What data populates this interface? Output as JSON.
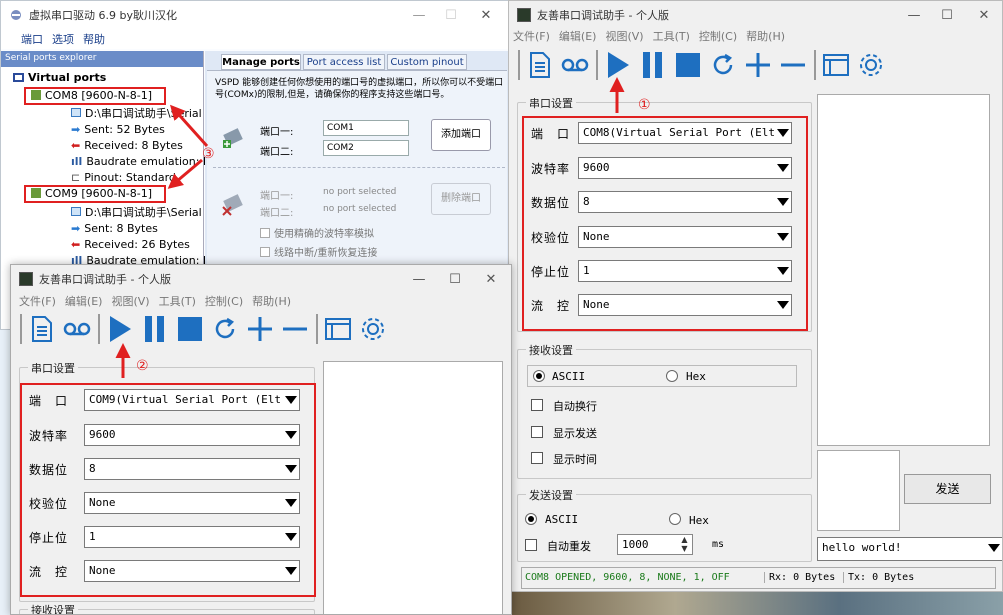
{
  "vspd": {
    "title": "虚拟串口驱动 6.9 by耿川汉化",
    "menu": [
      "端口",
      "选项",
      "帮助"
    ],
    "explorer_title": "Serial ports explorer",
    "tree": {
      "root": "Virtual ports",
      "com8": "COM8 [9600-N-8-1]",
      "com8_items": [
        "D:\\串口调试助手\\Serial Po",
        "Sent: 52 Bytes",
        "Received: 8 Bytes",
        "Baudrate emulation: Dis",
        "Pinout: Standard"
      ],
      "com9": "COM9 [9600-N-8-1]",
      "com9_items": [
        "D:\\串口调试助手\\Serial Po",
        "Sent: 8 Bytes",
        "Received: 26 Bytes",
        "Baudrate emulation: Dis"
      ]
    },
    "tabs": [
      "Manage ports",
      "Port access list",
      "Custom pinout"
    ],
    "desc": "VSPD 能够创建任何你想使用的端口号的虚拟端口，所以你可以不受端口号(COMx)的限制,但是，请确保你的程序支持这些端口号。",
    "port1_label": "端口一:",
    "port1_value": "COM1",
    "port2_label": "端口二:",
    "port2_value": "COM2",
    "add_button": "添加端口",
    "del_port1_label": "端口一:",
    "del_port1_value": "no port selected",
    "del_port2_label": "端口二:",
    "del_port2_value": "no port selected",
    "del_button": "删除端口",
    "opt1": "使用精确的波特率模拟",
    "opt2": "线路中断/重新恢复连接"
  },
  "right": {
    "title": "友善串口调试助手 - 个人版",
    "menu": [
      "文件(F)",
      "编辑(E)",
      "视图(V)",
      "工具(T)",
      "控制(C)",
      "帮助(H)"
    ],
    "serial_group": "串口设置",
    "fields": [
      {
        "label": "端　口",
        "value": "COM8(Virtual Serial Port (Elt"
      },
      {
        "label": "波特率",
        "value": "9600"
      },
      {
        "label": "数据位",
        "value": "8"
      },
      {
        "label": "校验位",
        "value": "None"
      },
      {
        "label": "停止位",
        "value": "1"
      },
      {
        "label": "流　控",
        "value": "None"
      }
    ],
    "recv_group": "接收设置",
    "recv_ascii": "ASCII",
    "recv_hex": "Hex",
    "recv_checks": [
      "自动换行",
      "显示发送",
      "显示时间"
    ],
    "send_group": "发送设置",
    "send_ascii": "ASCII",
    "send_hex": "Hex",
    "auto_resend": "自动重发",
    "interval": "1000",
    "interval_unit": "ms",
    "send_button": "发送",
    "send_text": "hello world!",
    "status": [
      "COM8 OPENED, 9600, 8, NONE, 1, OFF",
      "Rx: 0 Bytes",
      "Tx: 0 Bytes"
    ],
    "marker": "①"
  },
  "left": {
    "title": "友善串口调试助手 - 个人版",
    "menu": [
      "文件(F)",
      "编辑(E)",
      "视图(V)",
      "工具(T)",
      "控制(C)",
      "帮助(H)"
    ],
    "serial_group": "串口设置",
    "fields": [
      {
        "label": "端　口",
        "value": "COM9(Virtual Serial Port (Elt"
      },
      {
        "label": "波特率",
        "value": "9600"
      },
      {
        "label": "数据位",
        "value": "8"
      },
      {
        "label": "校验位",
        "value": "None"
      },
      {
        "label": "停止位",
        "value": "1"
      },
      {
        "label": "流　控",
        "value": "None"
      }
    ],
    "recv_group": "接收设置",
    "marker": "②"
  },
  "marker3": "③",
  "colors": {
    "accent": "#1e6fc0",
    "annotation": "#e02020",
    "status_text": "#1a7a1a"
  }
}
